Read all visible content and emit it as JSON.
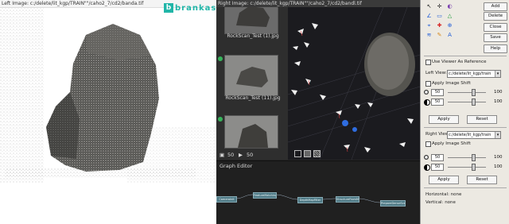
{
  "left_viewer": {
    "title": "Left Image: c:/delete/lit_kgp/TRAIN\"\"/caho2_7/cd2/banda.tif"
  },
  "right_viewer": {
    "title": "Right Image: c:/delete/lit_kgp/TRAIN\"\"/caho2_7/cd2/bandl.tif"
  },
  "watermark": {
    "logo": "b",
    "text": "brankaspedia"
  },
  "thumbnails": [
    {
      "caption": "RockScan_Test (1).jpg"
    },
    {
      "caption": "RockScan_Test (11).jpg"
    },
    {
      "caption": ""
    }
  ],
  "thumb_footer": {
    "count_a": "50",
    "count_b": "50"
  },
  "graph_editor": {
    "label": "Graph Editor",
    "nodes": [
      "CameraInit",
      "FeatureMatching",
      "DepthMapFilter",
      "StructureFromMotion",
      "PrepareDenseScene"
    ]
  },
  "tool_panel": {
    "buttons": [
      "Add",
      "Delete",
      "Close",
      "Save",
      "Help"
    ],
    "use_viewer_ref": "Use Viewer As Reference",
    "left_view_label": "Left View:",
    "left_view_value": "c:/delete/lit_kgp/train",
    "apply_shift_left": "Apply Image Shift",
    "left_spin_1": "50",
    "left_spin_2": "50",
    "left_val_1": "100",
    "left_val_2": "100",
    "apply_left": "Apply",
    "reset_left": "Reset",
    "right_view_label": "Right View:",
    "right_view_value": "c:/delete/lit_kgp/train",
    "apply_shift_right": "Apply Image Shift",
    "right_spin_1": "50",
    "right_spin_2": "50",
    "right_val_1": "100",
    "right_val_2": "100",
    "apply_right": "Apply",
    "reset_right": "Reset",
    "horizontal": "Horizontal: none",
    "vertical": "Vertical: none"
  },
  "tools": [
    {
      "glyph": "↖",
      "color": "#222222"
    },
    {
      "glyph": "✛",
      "color": "#222222"
    },
    {
      "glyph": "◐",
      "color": "#7a3fb0"
    },
    {
      "glyph": "∠",
      "color": "#1e5bd6"
    },
    {
      "glyph": "▭",
      "color": "#1e5bd6"
    },
    {
      "glyph": "△",
      "color": "#1e9b3b"
    },
    {
      "glyph": "⌖",
      "color": "#1e5bd6"
    },
    {
      "glyph": "✚",
      "color": "#d62222"
    },
    {
      "glyph": "⊕",
      "color": "#1e5bd6"
    },
    {
      "glyph": "≋",
      "color": "#1e5bd6"
    },
    {
      "glyph": "✎",
      "color": "#d68a1e"
    },
    {
      "glyph": "A",
      "color": "#1e5bd6"
    }
  ]
}
